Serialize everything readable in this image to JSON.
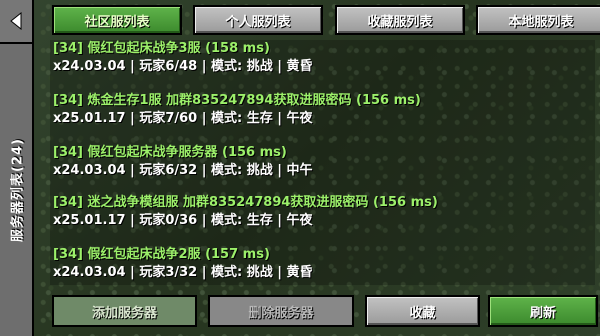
{
  "sidebar": {
    "title": "服务器列表(24)"
  },
  "tabs": [
    {
      "label": "社区服列表",
      "active": true
    },
    {
      "label": "个人服列表",
      "active": false
    },
    {
      "label": "收藏服列表",
      "active": false
    },
    {
      "label": "本地服列表",
      "active": false
    }
  ],
  "servers": [
    {
      "name": "[34] 假红包起床战争3服 (158 ms)",
      "info": "x24.03.04 | 玩家6/48 | 模式: 挑战 | 黄昏"
    },
    {
      "name": "[34] 炼金生存1服 加群835247894获取进服密码 (156 ms)",
      "info": "x25.01.17 | 玩家7/60 | 模式: 生存 | 午夜"
    },
    {
      "name": "[34] 假红包起床战争服务器 (156 ms)",
      "info": "x24.03.04 | 玩家6/32 | 模式: 挑战 | 中午"
    },
    {
      "name": "[34] 迷之战争模组服 加群835247894获取进服密码 (156 ms)",
      "info": "x25.01.17 | 玩家0/36 | 模式: 生存 | 午夜"
    },
    {
      "name": "[34] 假红包起床战争2服 (157 ms)",
      "info": "x24.03.04 | 玩家3/32 | 模式: 挑战 | 黄昏"
    }
  ],
  "buttons": {
    "add": "添加服务器",
    "delete": "删除服务器",
    "favorite": "收藏",
    "refresh": "刷新"
  },
  "colors": {
    "accent_green": "#4ea23b",
    "server_name": "#9cf06a"
  },
  "icons": {
    "back": "back-arrow-icon"
  }
}
